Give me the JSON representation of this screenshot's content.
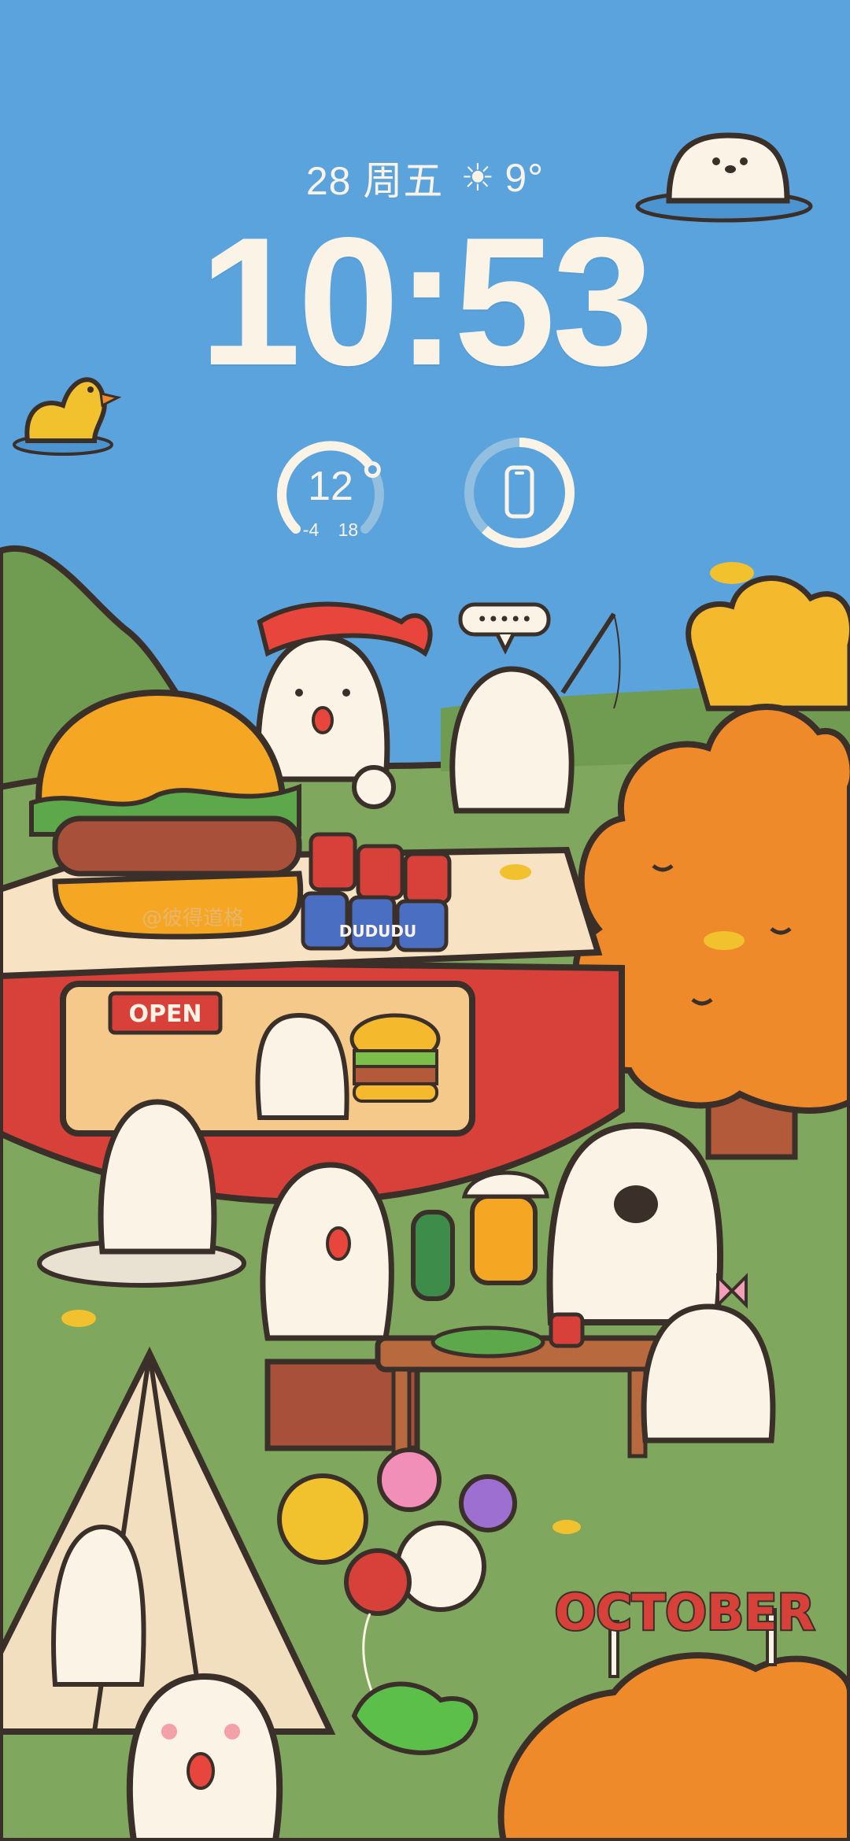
{
  "lockscreen": {
    "date": "28 周五",
    "weather_temp": "9°",
    "time": "10:53",
    "temperature_widget": {
      "current": "12",
      "low": "-4",
      "high": "18",
      "gauge_fraction": 0.72
    },
    "battery_widget": {
      "icon": "phone-icon",
      "ring_fraction": 0.62
    }
  },
  "wallpaper": {
    "open_sign": "OPEN",
    "stall_letters": "DUDUDU",
    "october_banner": "OCTOBER",
    "watermark": "@彼得道格",
    "speech_dots": "•••••"
  },
  "colors": {
    "sky": "#5aa3dc",
    "grass": "#7fa85e",
    "orange_tree": "#ef8a2a",
    "stall_red": "#d8413a",
    "cream": "#fbf4e6",
    "outline": "#3b2f2a"
  }
}
